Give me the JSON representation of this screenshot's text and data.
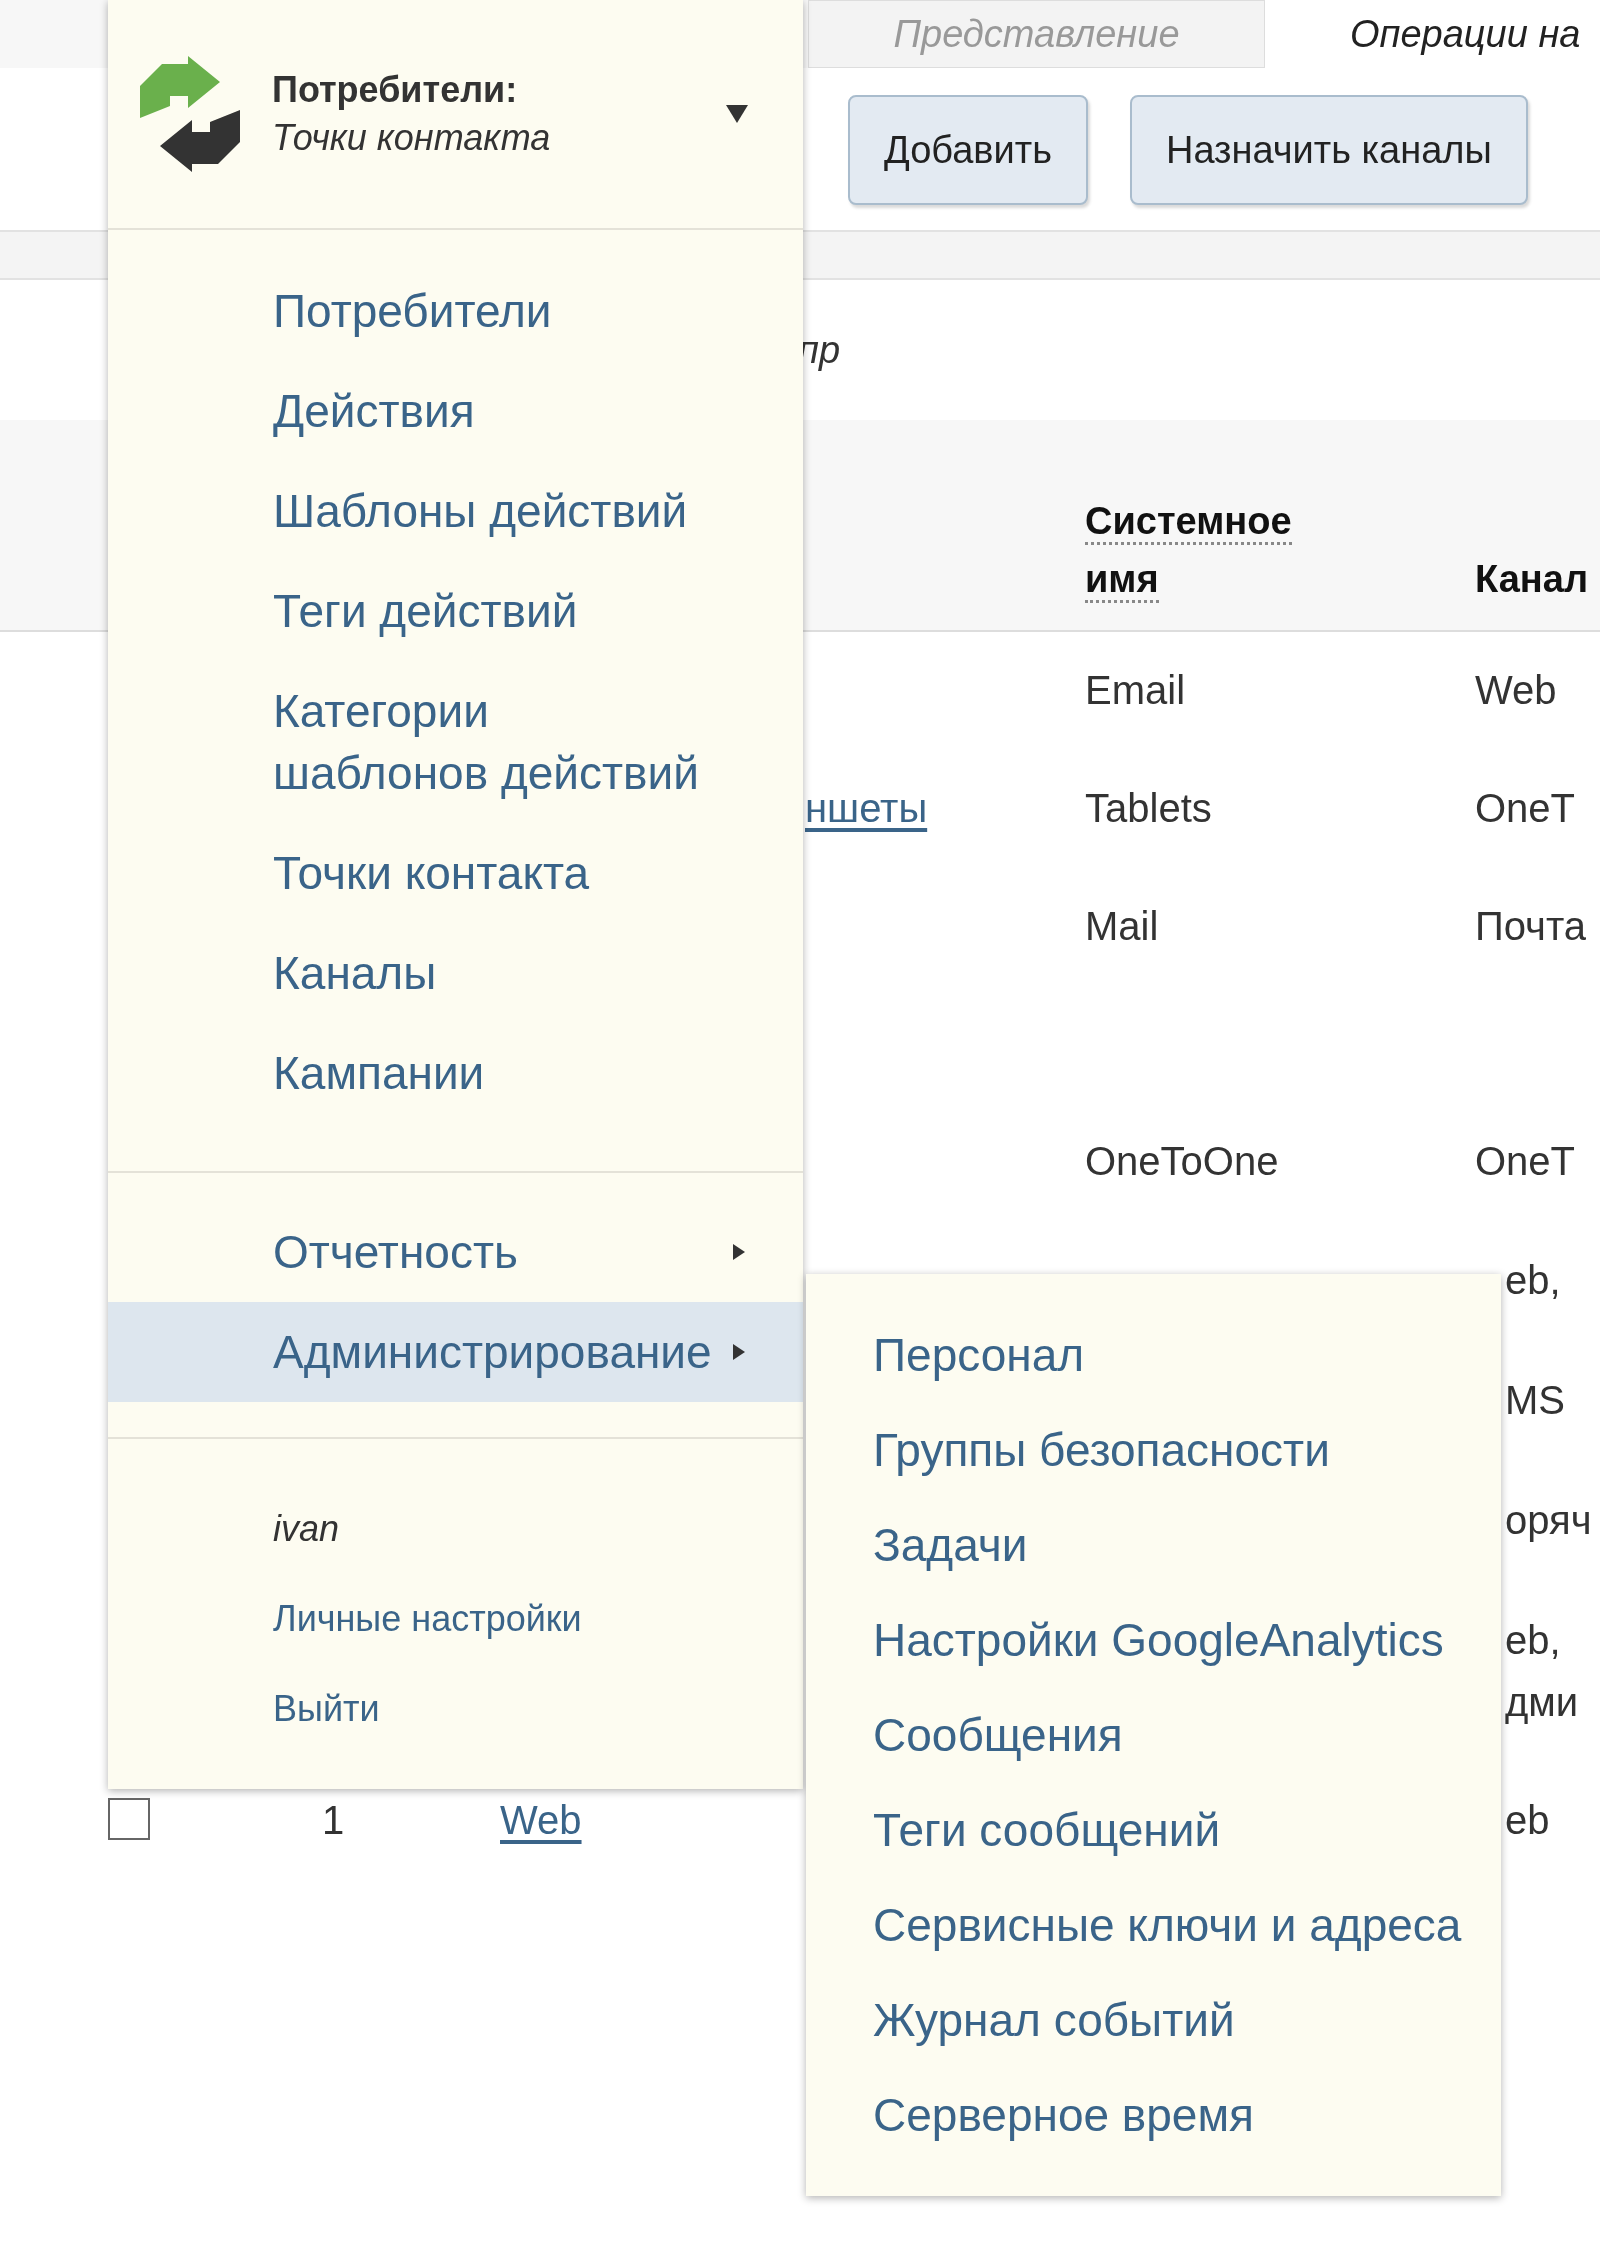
{
  "tabs": [
    {
      "label": "Представление",
      "selected": false
    },
    {
      "label": "Операции на",
      "selected": true
    }
  ],
  "toolbar_buttons": [
    "Добавить",
    "Назначить каналы"
  ],
  "filter": {
    "text": "пр"
  },
  "table": {
    "columns": [
      {
        "label": "Системное имя",
        "has_hint": true
      },
      {
        "label": "Канал",
        "has_hint": false
      }
    ],
    "rows": [
      {
        "system_name": "Email",
        "channel": "Web"
      },
      {
        "name": "ншеты",
        "system_name": "Tablets",
        "channel": "OneT"
      },
      {
        "system_name": "Mail",
        "channel": "Почта"
      },
      {
        "system_name": "OneToOne",
        "channel": "OneT"
      },
      {
        "channel": "eb,"
      },
      {
        "channel": "MS"
      },
      {
        "channel": "оряч"
      },
      {
        "channel": "eb,\nдми"
      },
      {
        "checked": false,
        "number": "1",
        "name": "Web",
        "channel": "eb"
      }
    ]
  },
  "menu": {
    "section": "Потребители:",
    "page": "Точки контакта",
    "items": [
      "Потребители",
      "Действия",
      "Шаблоны действий",
      "Теги действий",
      "Категории шаблонов действий",
      "Точки контакта",
      "Каналы",
      "Кампании"
    ],
    "groups": [
      {
        "label": "Отчетность",
        "has_submenu": true,
        "selected": false
      },
      {
        "label": "Администрирование",
        "has_submenu": true,
        "selected": true
      }
    ],
    "user": {
      "name": "ivan",
      "links": [
        "Личные настройки",
        "Выйти"
      ]
    }
  },
  "submenu": {
    "items": [
      "Персонал",
      "Группы безопасности",
      "Задачи",
      "Настройки GoogleAnalytics",
      "Сообщения",
      "Теги сообщений",
      "Сервисные ключи и адреса",
      "Журнал событий",
      "Серверное время"
    ]
  }
}
